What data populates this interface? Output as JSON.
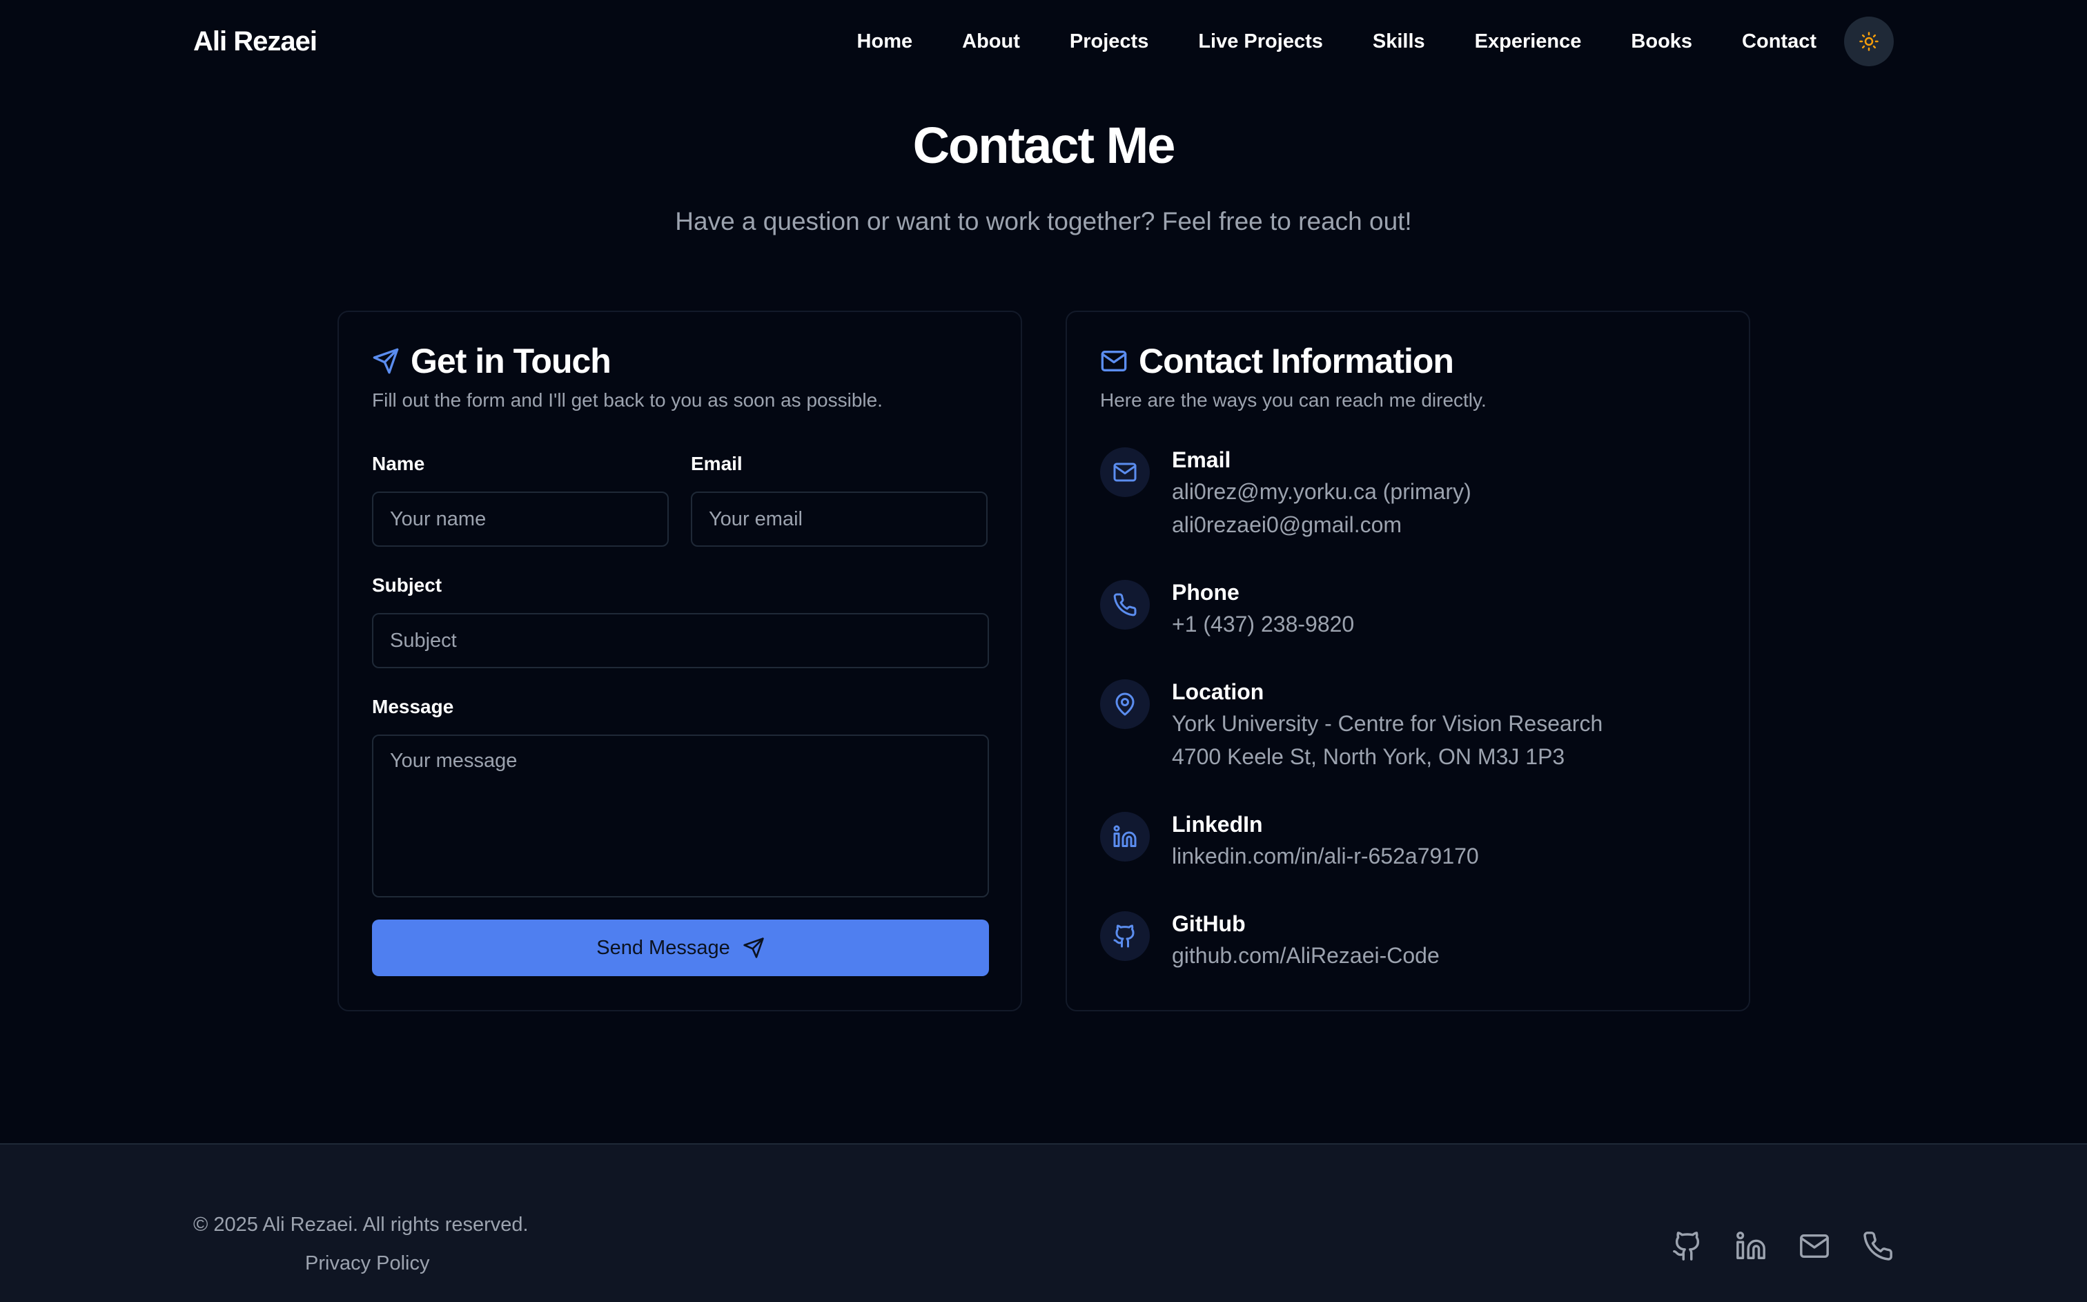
{
  "brand": "Ali Rezaei",
  "nav": {
    "items": [
      "Home",
      "About",
      "Projects",
      "Live Projects",
      "Skills",
      "Experience",
      "Books",
      "Contact"
    ],
    "theme_toggle_icon": "sun-icon"
  },
  "hero": {
    "title": "Contact Me",
    "subtitle": "Have a question or want to work together? Feel free to reach out!"
  },
  "form_card": {
    "icon": "send-icon",
    "title": "Get in Touch",
    "description": "Fill out the form and I'll get back to you as soon as possible.",
    "name_label": "Name",
    "name_placeholder": "Your name",
    "email_label": "Email",
    "email_placeholder": "Your email",
    "subject_label": "Subject",
    "subject_placeholder": "Subject",
    "message_label": "Message",
    "message_placeholder": "Your message",
    "submit_label": "Send Message"
  },
  "info_card": {
    "icon": "mail-icon",
    "title": "Contact Information",
    "description": "Here are the ways you can reach me directly.",
    "items": [
      {
        "icon": "mail-icon",
        "title": "Email",
        "lines": [
          "ali0rez@my.yorku.ca (primary)",
          "ali0rezaei0@gmail.com"
        ]
      },
      {
        "icon": "phone-icon",
        "title": "Phone",
        "lines": [
          "+1 (437) 238-9820"
        ]
      },
      {
        "icon": "map-pin-icon",
        "title": "Location",
        "lines": [
          "York University - Centre for Vision Research",
          "4700 Keele St, North York, ON M3J 1P3"
        ]
      },
      {
        "icon": "linkedin-icon",
        "title": "LinkedIn",
        "lines": [
          "linkedin.com/in/ali-r-652a79170"
        ]
      },
      {
        "icon": "github-icon",
        "title": "GitHub",
        "lines": [
          "github.com/AliRezaei-Code"
        ]
      }
    ]
  },
  "footer": {
    "copyright": "© 2025 Ali Rezaei. All rights reserved.",
    "privacy": "Privacy Policy",
    "social_icons": [
      "github-icon",
      "linkedin-icon",
      "mail-icon",
      "phone-icon"
    ]
  },
  "colors": {
    "background": "#030712",
    "accent": "#4f7ff0",
    "icon_accent": "#5b8def",
    "muted_text": "#9ca3af",
    "footer_bg": "#0f1523",
    "sun": "#f59e0b"
  }
}
